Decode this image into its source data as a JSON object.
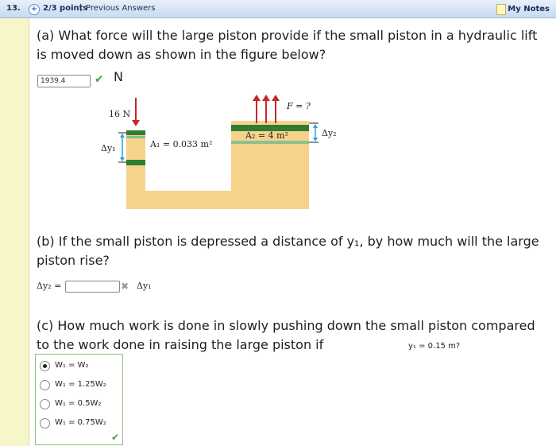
{
  "header": {
    "question_number": "13.",
    "points": "2/3 points",
    "separator": "|",
    "previous_answers": "Previous Answers",
    "my_notes": "My Notes"
  },
  "part_a": {
    "question": "(a) What force will the large piston provide if the small piston in a hydraulic lift is moved down as shown in the figure below?",
    "answer_value": "1939.4",
    "unit": "N",
    "status": "correct"
  },
  "figure": {
    "small_force": "16 N",
    "large_force": "F = ?",
    "small_area": "A₁ = 0.033 m²",
    "large_area": "A₂ = 4 m²",
    "dy1": "Δy₁",
    "dy2": "Δy₂",
    "colors": {
      "fluid": "#f7d28a",
      "piston": "#2e7d32",
      "piston_light": "#8bbf8e",
      "arrow": "#c62828",
      "dim": "#29a3d6"
    }
  },
  "part_b": {
    "question": "(b) If the small piston is depressed a distance of y₁, by how much will the large piston rise?",
    "lhs": "Δy₂ =",
    "answer_value": "",
    "rhs": "Δy₁",
    "status": "incorrect"
  },
  "part_c": {
    "question": "(c) How much work is done in slowly pushing down the small piston compared to the work done in raising the large piston if",
    "condition": "y₁ = 0.15 m?",
    "options": [
      {
        "label": "W₁ = W₂",
        "selected": true
      },
      {
        "label": "W₁ = 1.25W₂",
        "selected": false
      },
      {
        "label": "W₁ = 0.5W₂",
        "selected": false
      },
      {
        "label": "W₁ = 0.75W₂",
        "selected": false
      }
    ],
    "status": "correct"
  }
}
